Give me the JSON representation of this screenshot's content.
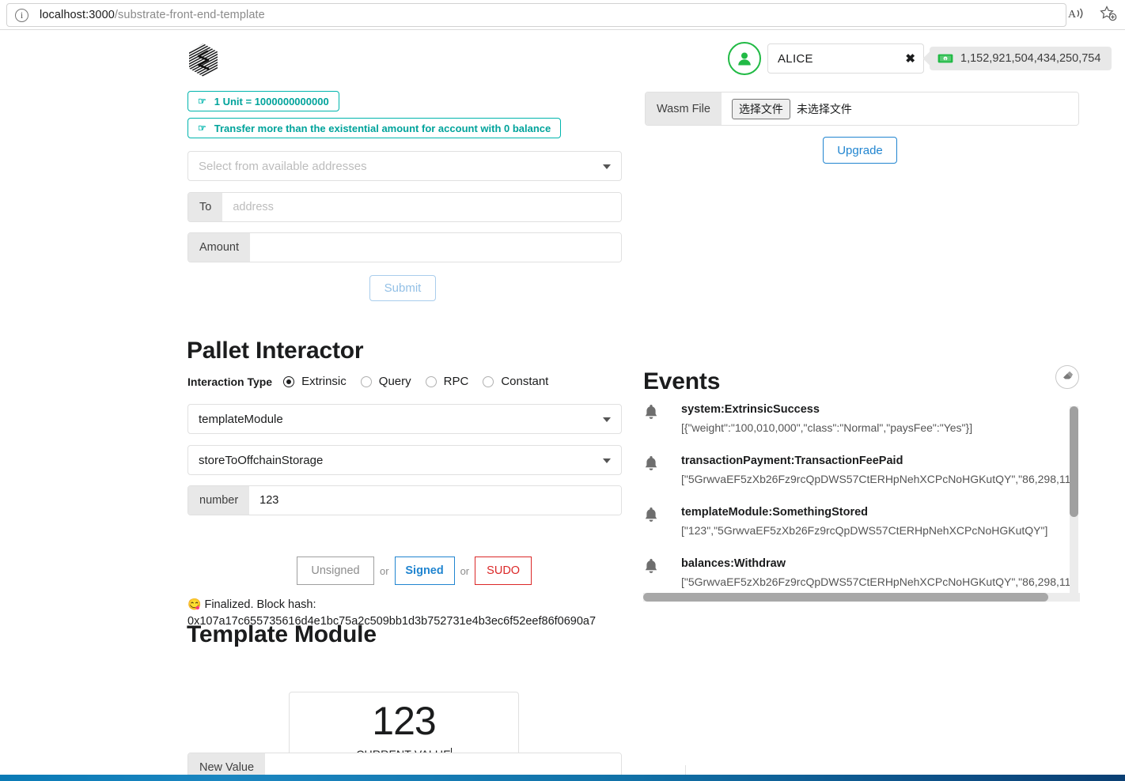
{
  "browser": {
    "url_host": "localhost:3000",
    "url_path": "/substrate-front-end-template",
    "info_icon": "info-icon",
    "read_aloud_icon": "read-aloud-icon",
    "favorites_icon": "add-to-favorites-icon"
  },
  "header": {
    "logo_icon": "substrate-logo-icon",
    "avatar_icon": "user-avatar-icon",
    "account_name": "ALICE",
    "clear_symbol": "✖",
    "money_icon": "banknote-icon",
    "balance": "1,152,921,504,434,250,754"
  },
  "hints": [
    {
      "text": "1 Unit = 1000000000000"
    },
    {
      "text": "Transfer more than the existential amount for account with 0 balance"
    }
  ],
  "transfer": {
    "address_select_placeholder": "Select from available addresses",
    "to_label": "To",
    "to_placeholder": "address",
    "amount_label": "Amount",
    "amount_value": "",
    "submit_label": "Submit"
  },
  "upgrade": {
    "wasm_label": "Wasm File",
    "choose_file_button": "选择文件",
    "no_file_text": "未选择文件",
    "upgrade_label": "Upgrade"
  },
  "pallet": {
    "title": "Pallet Interactor",
    "interaction_type_label": "Interaction Type",
    "options": [
      {
        "label": "Extrinsic",
        "selected": true
      },
      {
        "label": "Query",
        "selected": false
      },
      {
        "label": "RPC",
        "selected": false
      },
      {
        "label": "Constant",
        "selected": false
      }
    ],
    "module": "templateModule",
    "callable": "storeToOffchainStorage",
    "param_label": "number",
    "param_value": "123",
    "sign_unsigned": "Unsigned",
    "sign_signed": "Signed",
    "sign_sudo": "SUDO",
    "or_label": "or",
    "status_emoji": "😋",
    "status_text": "Finalized. Block hash:",
    "block_hash": "0x107a17c655735616d4e1bc75a2c509bb1d3b752731e4b3ec6f52eef86f0690a7"
  },
  "template_module": {
    "title": "Template Module",
    "current_value": "123",
    "current_value_caption": "CURRENT VALUE",
    "new_value_label": "New Value",
    "new_value": ""
  },
  "events": {
    "title": "Events",
    "clear_icon": "eraser-icon",
    "items": [
      {
        "bell_icon": "bell-icon",
        "name": "system:ExtrinsicSuccess",
        "args": "[{\"weight\":\"100,010,000\",\"class\":\"Normal\",\"paysFee\":\"Yes\"}]"
      },
      {
        "bell_icon": "bell-icon",
        "name": "transactionPayment:TransactionFeePaid",
        "args": "[\"5GrwvaEF5zXb26Fz9rcQpDWS57CtERHpNehXCPcNoHGKutQY\",\"86,298,11"
      },
      {
        "bell_icon": "bell-icon",
        "name": "templateModule:SomethingStored",
        "args": "[\"123\",\"5GrwvaEF5zXb26Fz9rcQpDWS57CtERHpNehXCPcNoHGKutQY\"]"
      },
      {
        "bell_icon": "bell-icon",
        "name": "balances:Withdraw",
        "args": "[\"5GrwvaEF5zXb26Fz9rcQpDWS57CtERHpNehXCPcNoHGKutQY\",\"86,298,11"
      }
    ]
  },
  "colors": {
    "teal": "#00b5ad",
    "green": "#21ba45",
    "blue": "#2185d0",
    "red": "#db2828",
    "grey_label": "#e8e8e8"
  }
}
